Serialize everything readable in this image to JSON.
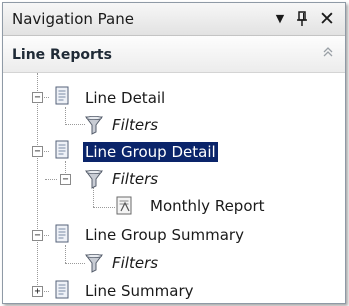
{
  "pane": {
    "title": "Navigation Pane"
  },
  "titlebar_buttons": {
    "menu": "▼",
    "pin": "ᵽ",
    "close": "✕"
  },
  "section": {
    "title": "Line Reports",
    "collapse_glyph": "⌃"
  },
  "tree": {
    "expand_glyphs": {
      "expanded": "−",
      "collapsed": "+"
    },
    "items": [
      {
        "label": "Line Detail",
        "icon": "report-icon",
        "expanded": true
      },
      {
        "label": "Filters",
        "icon": "filter-icon"
      },
      {
        "label": "Line Group Detail",
        "icon": "report-icon",
        "expanded": true,
        "selected": true
      },
      {
        "label": "Filters",
        "icon": "filter-icon",
        "expanded": true
      },
      {
        "label": "Monthly Report",
        "icon": "report-icon"
      },
      {
        "label": "Line Group Summary",
        "icon": "report-icon",
        "expanded": true
      },
      {
        "label": "Filters",
        "icon": "filter-icon"
      },
      {
        "label": "Line Summary",
        "icon": "report-icon",
        "expanded": false
      }
    ]
  }
}
